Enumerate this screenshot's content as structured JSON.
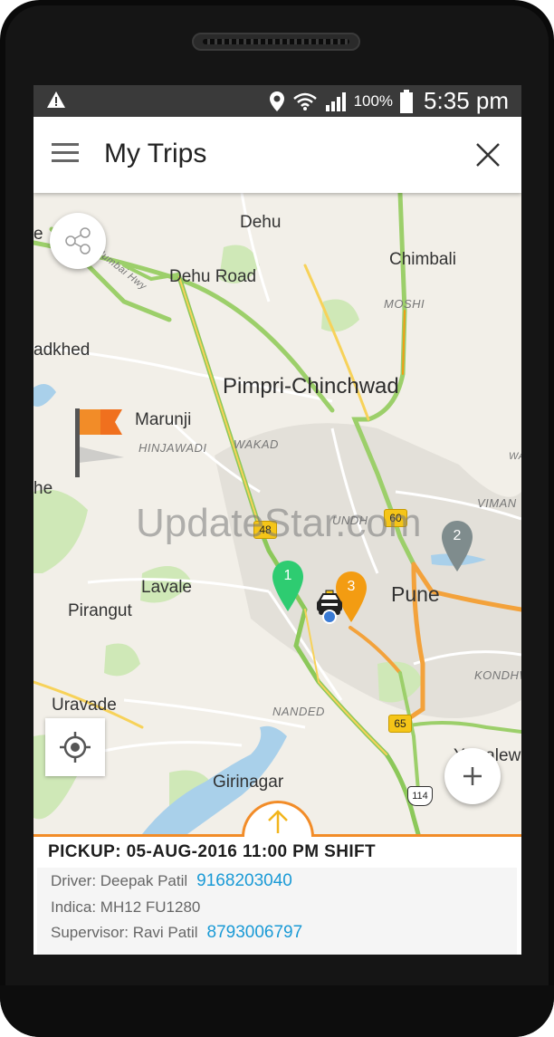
{
  "status_bar": {
    "battery_percent": "100%",
    "time": "5:35 pm",
    "icons": [
      "warning-icon",
      "location-icon",
      "wifi-icon",
      "signal-icon",
      "battery-icon"
    ]
  },
  "app_bar": {
    "title": "My Trips",
    "menu_icon": "menu-icon",
    "close_icon": "close-icon"
  },
  "map": {
    "place_labels": {
      "e": "e",
      "dehu": "Dehu",
      "chimbali": "Chimbali",
      "dehu_road": "Dehu Road",
      "moshi": "MOSHI",
      "adkhed": "adkhed",
      "pimpri": "Pimpri-Chinchwad",
      "marunji": "Marunji",
      "hinjawadi": "HINJAWADI",
      "wakad": "WAKAD",
      "he": "he",
      "viman": "VIMAN",
      "aundh": "UNDH",
      "lavale": "Lavale",
      "pune": "Pune",
      "pirangut": "Pirangut",
      "kondhwa": "KONDHWA",
      "uravade": "Uravade",
      "nanded": "NANDED",
      "yewalewadi": "Yewalewad",
      "girinagar": "Girinagar",
      "mumbai_hwy": "Mumbai Hwy",
      "wakad_partial": "WAK"
    },
    "road_shields": [
      "48",
      "60",
      "65",
      "114"
    ],
    "watermark": "UpdateStar.com",
    "markers": [
      {
        "label": "1",
        "color": "#2ecc71"
      },
      {
        "label": "2",
        "color": "#7f8c8d"
      },
      {
        "label": "3",
        "color": "#f39c12"
      }
    ],
    "controls": {
      "share_icon": "share-icon",
      "locate_icon": "my-location-icon",
      "zoom_icon": "plus-icon",
      "flag_icon": "flag-icon",
      "car_icon": "taxi-icon"
    }
  },
  "trip": {
    "expand_icon": "arrow-up-icon",
    "pickup": "PICKUP: 05-AUG-2016 11:00 PM SHIFT",
    "driver_label": "Driver: Deepak Patil",
    "driver_phone": "9168203040",
    "vehicle": "Indica: MH12 FU1280",
    "supervisor_label": "Supervisor: Ravi Patil",
    "supervisor_phone": "8793006797"
  },
  "colors": {
    "accent": "#f28c28",
    "link": "#1a9ad6",
    "status_bar": "#3a3a3a"
  }
}
